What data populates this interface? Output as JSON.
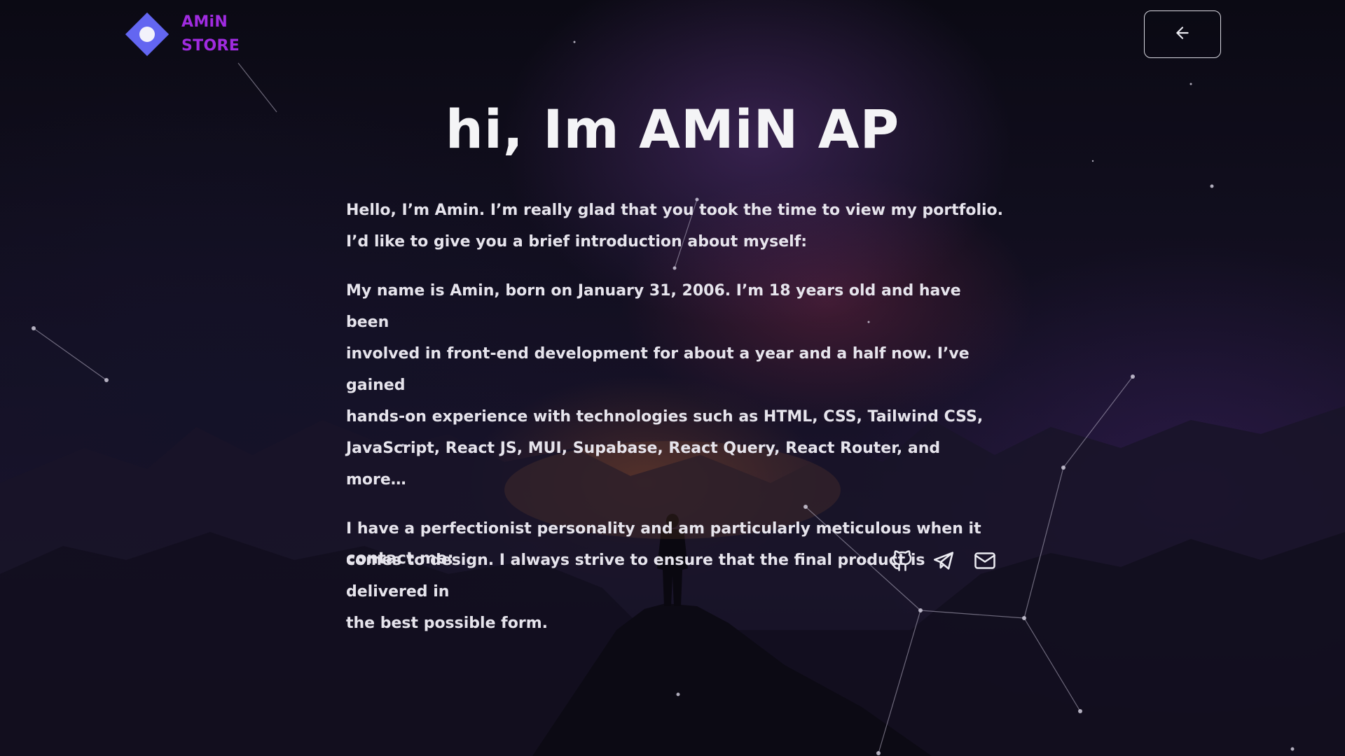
{
  "header": {
    "logo_line1": "AMiN",
    "logo_line2": "STORE",
    "logo_icon": "diamond-logo-icon",
    "back_icon": "arrow-left-icon"
  },
  "main": {
    "title": "hi, Im AMiN AP",
    "paragraphs": [
      "Hello, I’m Amin. I’m really glad that you took the time to view my portfolio.\nI’d like to give you a brief introduction about myself:",
      "My name is Amin, born on January 31, 2006. I’m 18 years old and have been\ninvolved in front-end development for about a year and a half now. I’ve gained\nhands-on experience with technologies such as HTML, CSS, Tailwind CSS,\nJavaScript, React JS, MUI, Supabase, React Query, React Router, and more…",
      "I have a perfectionist personality and am particularly meticulous when it\ncomes to design. I always strive to ensure that the final product is delivered in\nthe best possible form."
    ],
    "contact_label": "contact me:",
    "socials": [
      {
        "icon": "github-icon"
      },
      {
        "icon": "telegram-icon"
      },
      {
        "icon": "mail-icon"
      }
    ]
  },
  "colors": {
    "brand": "#a02be0",
    "logo_diamond": "#6366f1",
    "text": "#e6e4ec",
    "title": "#f4f4f6"
  }
}
